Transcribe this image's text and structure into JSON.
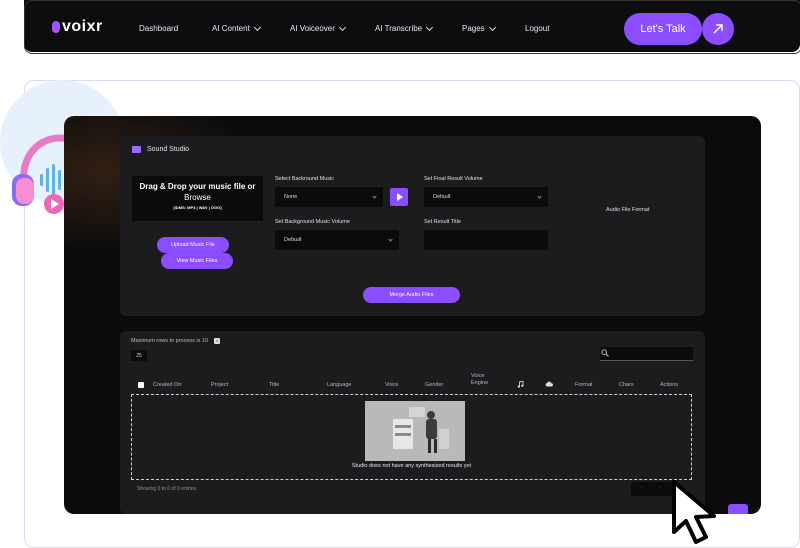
{
  "nav": {
    "logo": "voixr",
    "links": [
      {
        "label": "Dashboard"
      },
      {
        "label": "AI Content"
      },
      {
        "label": "AI Voiceover"
      },
      {
        "label": "AI Transcribe"
      },
      {
        "label": "Pages"
      },
      {
        "label": "Logout"
      }
    ],
    "cta": "Let's Talk"
  },
  "studio": {
    "title": "Sound Studio",
    "dropzone": {
      "title": "Drag & Drop your music file or",
      "subtitle": "Browse",
      "formats": "[IDMS: MP3 | WAV | OGG]"
    },
    "upload_button": "Upload Music File",
    "view_button": "View Music Files",
    "background_music_label": "Select Backround Music",
    "background_music_value": "None",
    "final_volume_label": "Set Final Result Volume",
    "final_volume_value": "Default",
    "bg_volume_label": "Set Background Music Volume",
    "bg_volume_value": "Default",
    "result_title_label": "Set Result Title",
    "result_title_value": "",
    "audio_format_label": "Audio File Format",
    "merge_button": "Merge Audio Files"
  },
  "table": {
    "max_rows_note": "Maximum rows to process is 10",
    "rows_per_page": "25",
    "search_placeholder": "",
    "columns": [
      "Created On",
      "Project",
      "Title",
      "Language",
      "Voice",
      "Gender",
      "Voice Engine",
      "Format",
      "Chars",
      "Actions"
    ],
    "empty_message": "Studio does not have any synthesized results yet",
    "entries_info": "Showing 0 to 0 of 0 entries"
  },
  "colors": {
    "accent": "#8a4dff",
    "navbar": "#0d0d10",
    "screen": "#0b0b0d",
    "panel": "#1c1c1f"
  },
  "icons": [
    "microphone-logo-icon",
    "chevron-down-icon",
    "arrow-up-right-icon",
    "headphones-icon",
    "studio-icon",
    "play-icon",
    "info-icon",
    "search-icon",
    "music-note-icon",
    "cloud-icon",
    "cursor-icon"
  ]
}
